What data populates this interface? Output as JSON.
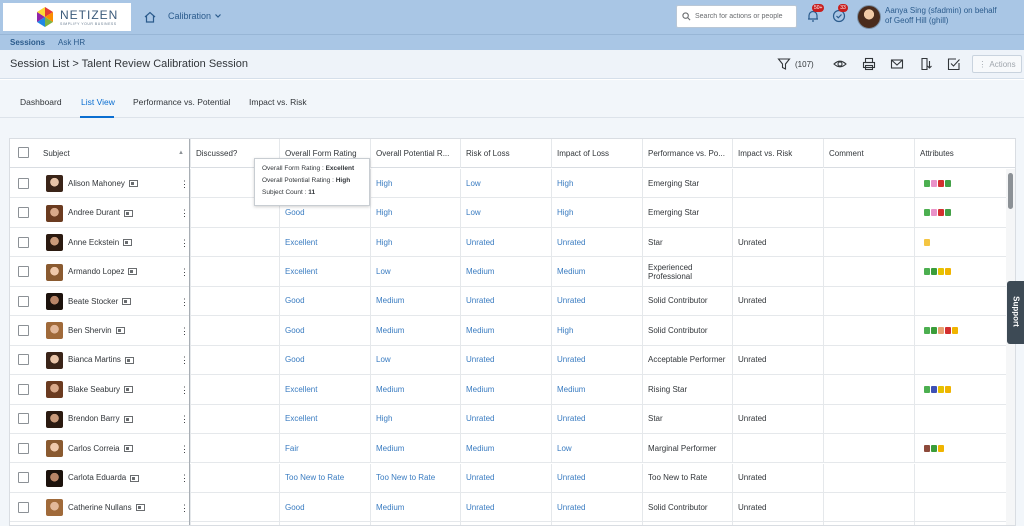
{
  "brand": {
    "name": "NETIZEN",
    "tagline": "SIMPLIFY YOUR BUSINESS"
  },
  "topbar": {
    "calibration_menu": "Calibration",
    "search_placeholder": "Search for actions or people",
    "notifications_badge": "50+",
    "tasks_badge": "33",
    "user_line1": "Aanya Sing (sfadmin) on behalf",
    "user_line2": "of Geoff Hill (ghill)"
  },
  "subnav": {
    "sessions": "Sessions",
    "ask_hr": "Ask HR"
  },
  "header": {
    "list_link": "Session List",
    "separator": ">",
    "session_name": "Talent Review Calibration Session",
    "filter_count": "(107)",
    "actions_label": "Actions"
  },
  "tabs": [
    "Dashboard",
    "List View",
    "Performance vs. Potential",
    "Impact vs. Risk"
  ],
  "columns": [
    "Subject",
    "Discussed?",
    "Overall Form Rating",
    "Overall Potential R...",
    "Risk of Loss",
    "Impact of Loss",
    "Performance vs. Po...",
    "Impact vs. Risk",
    "Comment",
    "Attributes"
  ],
  "rows": [
    {
      "name": "Alison Mahoney",
      "form": "",
      "potential": "High",
      "risk": "Low",
      "impact": "High",
      "pvp": "Emerging Star",
      "ivr": "",
      "attrs": [
        "#4caf50",
        "#e991c8",
        "#d32f2f",
        "#43a047"
      ]
    },
    {
      "name": "Andree Durant",
      "form": "Good",
      "potential": "High",
      "risk": "Low",
      "impact": "High",
      "pvp": "Emerging Star",
      "ivr": "",
      "attrs": [
        "#4caf50",
        "#e991c8",
        "#d32f2f",
        "#43a047"
      ]
    },
    {
      "name": "Anne Eckstein",
      "form": "Excellent",
      "potential": "High",
      "risk": "Unrated",
      "impact": "Unrated",
      "pvp": "Star",
      "ivr": "Unrated",
      "attrs": [
        "#f4c542"
      ]
    },
    {
      "name": "Armando Lopez",
      "form": "Excellent",
      "potential": "Low",
      "risk": "Medium",
      "impact": "Medium",
      "pvp": "Experienced Professional",
      "ivr": "",
      "attrs": [
        "#4caf50",
        "#3a9d3a",
        "#e6c200",
        "#f0b400"
      ]
    },
    {
      "name": "Beate Stocker",
      "form": "Good",
      "potential": "Medium",
      "risk": "Unrated",
      "impact": "Unrated",
      "pvp": "Solid Contributor",
      "ivr": "Unrated",
      "attrs": []
    },
    {
      "name": "Ben Shervin",
      "form": "Good",
      "potential": "Medium",
      "risk": "Medium",
      "impact": "High",
      "pvp": "Solid Contributor",
      "ivr": "",
      "attrs": [
        "#4caf50",
        "#3a9d3a",
        "#e8a070",
        "#d32f2f",
        "#f0b400"
      ]
    },
    {
      "name": "Bianca Martins",
      "form": "Good",
      "potential": "Low",
      "risk": "Unrated",
      "impact": "Unrated",
      "pvp": "Acceptable Performer",
      "ivr": "Unrated",
      "attrs": []
    },
    {
      "name": "Blake Seabury",
      "form": "Excellent",
      "potential": "Medium",
      "risk": "Medium",
      "impact": "Medium",
      "pvp": "Rising Star",
      "ivr": "",
      "attrs": [
        "#4caf50",
        "#3f51b5",
        "#e6c200",
        "#f0b400"
      ]
    },
    {
      "name": "Brendon Barry",
      "form": "Excellent",
      "potential": "High",
      "risk": "Unrated",
      "impact": "Unrated",
      "pvp": "Star",
      "ivr": "Unrated",
      "attrs": []
    },
    {
      "name": "Carlos Correia",
      "form": "Fair",
      "potential": "Medium",
      "risk": "Medium",
      "impact": "Low",
      "pvp": "Marginal Performer",
      "ivr": "",
      "attrs": [
        "#8d4a3a",
        "#3a9d3a",
        "#f0b400"
      ]
    },
    {
      "name": "Carlota Eduarda",
      "form": "Too New to Rate",
      "potential": "Too New to Rate",
      "risk": "Unrated",
      "impact": "Unrated",
      "pvp": "Too New to Rate",
      "ivr": "Unrated",
      "attrs": []
    },
    {
      "name": "Catherine Nullans",
      "form": "Good",
      "potential": "Medium",
      "risk": "Unrated",
      "impact": "Unrated",
      "pvp": "Solid Contributor",
      "ivr": "Unrated",
      "attrs": []
    },
    {
      "name": "",
      "form": "",
      "potential": "",
      "risk": "",
      "impact": "",
      "pvp": "",
      "ivr": "",
      "attrs": []
    }
  ],
  "tooltip": {
    "line1_label": "Overall Form Rating :",
    "line1_value": "Excellent",
    "line2_label": "Overall Potential Rating :",
    "line2_value": "High",
    "line3_label": "Subject Count :",
    "line3_value": "11"
  },
  "support_label": "Support"
}
